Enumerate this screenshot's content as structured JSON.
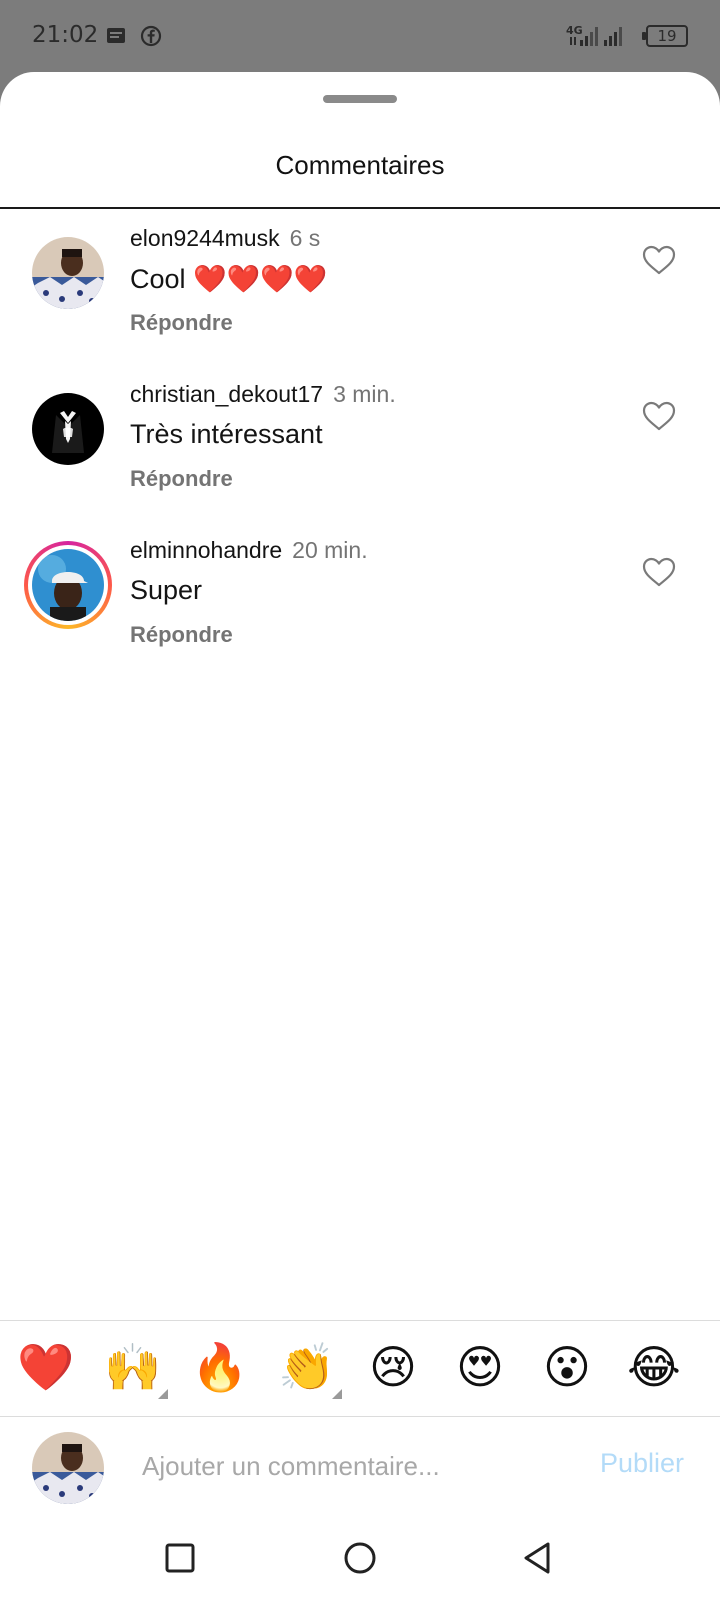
{
  "status_bar": {
    "time": "21:02",
    "battery": "19",
    "network": "4G",
    "icons": [
      "message-icon",
      "facebook-icon",
      "signal-icon",
      "battery-icon"
    ]
  },
  "sheet": {
    "title": "Commentaires"
  },
  "comments": [
    {
      "username": "elon9244musk",
      "time": "6 s",
      "text": "Cool ❤️❤️❤️❤️",
      "reply_label": "Répondre",
      "has_story_ring": false
    },
    {
      "username": "christian_dekout17",
      "time": "3 min.",
      "text": "Très intéressant",
      "reply_label": "Répondre",
      "has_story_ring": false
    },
    {
      "username": "elminnohandre",
      "time": "20 min.",
      "text": "Super",
      "reply_label": "Répondre",
      "has_story_ring": true
    }
  ],
  "emoji_bar": [
    "❤️",
    "🙌",
    "🔥",
    "👏",
    "😢",
    "😍",
    "😮",
    "😂"
  ],
  "composer": {
    "placeholder": "Ajouter un commentaire...",
    "value": "",
    "publish_label": "Publier"
  },
  "colors": {
    "status_bar_bg": "#7c7c7c",
    "text_primary": "#141414",
    "text_secondary": "#747474",
    "publish_disabled": "#b3dbf8",
    "story_ring": [
      "#d6249f",
      "#fd5949",
      "#fdb827"
    ]
  },
  "nav_bar": {
    "buttons": [
      "recents-square-icon",
      "home-circle-icon",
      "back-triangle-icon"
    ]
  }
}
